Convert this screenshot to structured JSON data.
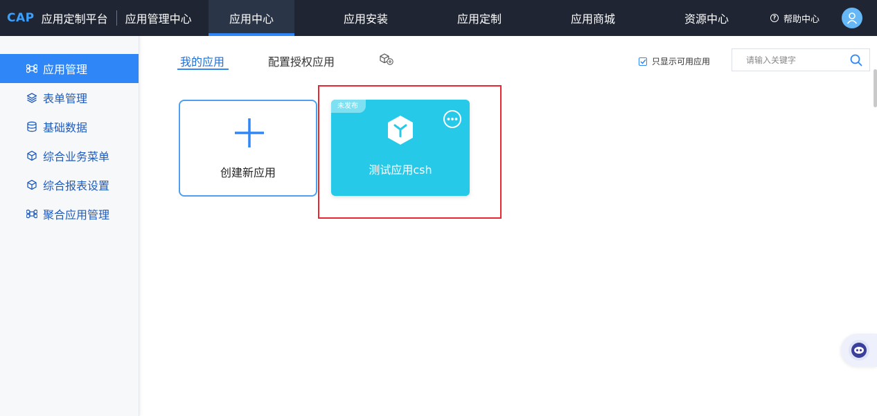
{
  "header": {
    "brand": "CAP",
    "platform": "应用定制平台",
    "center": "应用管理中心",
    "nav": [
      "应用中心",
      "应用安装",
      "应用定制",
      "应用商城",
      "资源中心"
    ],
    "help": "帮助中心",
    "accent": "#2f86f6",
    "background": "#1f2533"
  },
  "sidebar": {
    "items": [
      {
        "label": "应用管理",
        "icon": "command-icon"
      },
      {
        "label": "表单管理",
        "icon": "layers-icon"
      },
      {
        "label": "基础数据",
        "icon": "database-icon"
      },
      {
        "label": "综合业务菜单",
        "icon": "box-icon"
      },
      {
        "label": "综合报表设置",
        "icon": "box-icon"
      },
      {
        "label": "聚合应用管理",
        "icon": "command-icon"
      }
    ]
  },
  "main": {
    "tabs": [
      "我的应用",
      "配置授权应用"
    ],
    "filter_label": "只显示可用应用",
    "filter_checked": true,
    "search_placeholder": "请输入关键字",
    "create_label": "创建新应用",
    "app": {
      "badge": "未发布",
      "name": "测试应用csh",
      "color": "#26c9e8"
    },
    "highlight_color": "#e8262e"
  }
}
